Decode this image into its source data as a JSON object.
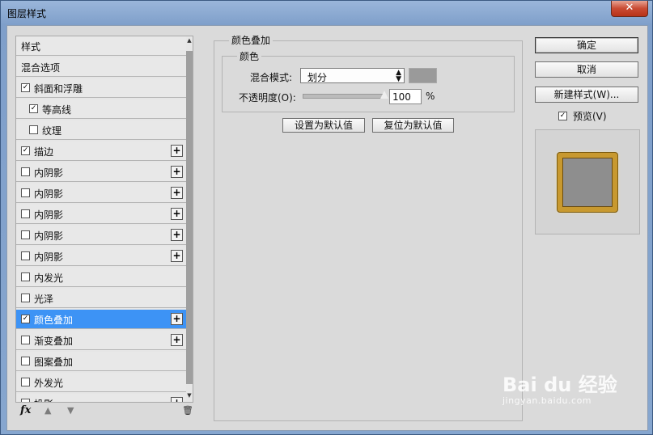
{
  "window": {
    "title": "图层样式",
    "close_glyph": "✕"
  },
  "sidebar": {
    "items": [
      {
        "label": "样式",
        "check": "none",
        "plus": false,
        "selected": false
      },
      {
        "label": "混合选项",
        "check": "none",
        "plus": false,
        "selected": false
      },
      {
        "label": "斜面和浮雕",
        "check": "checked",
        "plus": false,
        "selected": false
      },
      {
        "label": "等高线",
        "check": "checked",
        "plus": false,
        "selected": false,
        "indent": true
      },
      {
        "label": "纹理",
        "check": "unchecked",
        "plus": false,
        "selected": false,
        "indent": true
      },
      {
        "label": "描边",
        "check": "checked",
        "plus": true,
        "selected": false
      },
      {
        "label": "内阴影",
        "check": "unchecked",
        "plus": true,
        "selected": false
      },
      {
        "label": "内阴影",
        "check": "unchecked",
        "plus": true,
        "selected": false
      },
      {
        "label": "内阴影",
        "check": "unchecked",
        "plus": true,
        "selected": false
      },
      {
        "label": "内阴影",
        "check": "unchecked",
        "plus": true,
        "selected": false
      },
      {
        "label": "内阴影",
        "check": "unchecked",
        "plus": true,
        "selected": false
      },
      {
        "label": "内发光",
        "check": "unchecked",
        "plus": false,
        "selected": false
      },
      {
        "label": "光泽",
        "check": "unchecked",
        "plus": false,
        "selected": false
      },
      {
        "label": "颜色叠加",
        "check": "checked",
        "plus": true,
        "selected": true
      },
      {
        "label": "渐变叠加",
        "check": "unchecked",
        "plus": true,
        "selected": false
      },
      {
        "label": "图案叠加",
        "check": "unchecked",
        "plus": false,
        "selected": false
      },
      {
        "label": "外发光",
        "check": "unchecked",
        "plus": false,
        "selected": false
      },
      {
        "label": "投影",
        "check": "unchecked",
        "plus": true,
        "selected": false
      }
    ],
    "footer": {
      "fx": "fx",
      "up_icon": "▲",
      "down_icon": "▼",
      "trash_icon": "🗑"
    }
  },
  "panel": {
    "group_title": "颜色叠加",
    "sub_title": "颜色",
    "blend_mode_label": "混合模式:",
    "blend_mode_value": "划分",
    "overlay_color": "#9a9a9a",
    "opacity_label": "不透明度(O):",
    "opacity_value": "100",
    "opacity_unit": "%",
    "set_default": "设置为默认值",
    "reset_default": "复位为默认值"
  },
  "actions": {
    "ok": "确定",
    "cancel": "取消",
    "new_style": "新建样式(W)...",
    "preview_label": "预览(V)",
    "preview_checked": true
  },
  "watermark": {
    "brand": "Bai du 经验",
    "url": "jingyan.baidu.com"
  }
}
